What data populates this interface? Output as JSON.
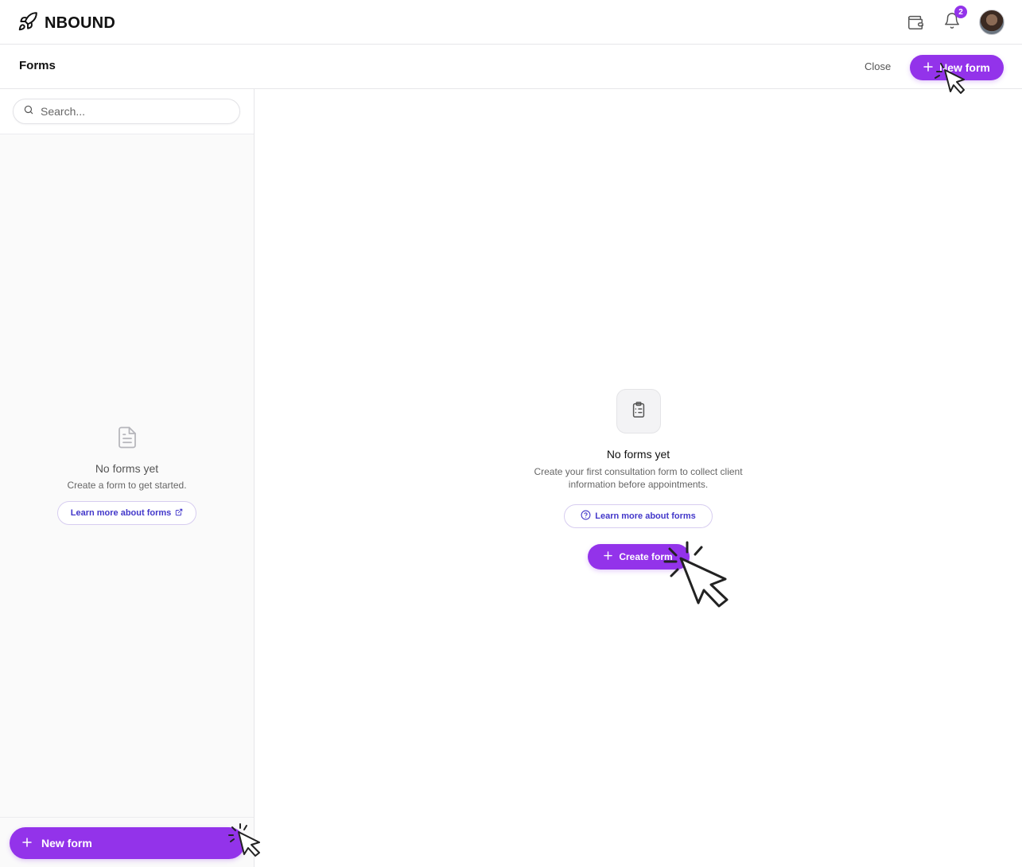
{
  "app": {
    "brand_name": "NBOUND",
    "notification_count": "2"
  },
  "header": {
    "title": "Forms",
    "close_label": "Close",
    "new_form_label": "New form"
  },
  "sidebar": {
    "search_placeholder": "Search...",
    "empty_title": "No forms yet",
    "empty_subtitle": "Create a form to get started.",
    "learn_more_label": "Learn more about forms",
    "new_form_label": "New form"
  },
  "main": {
    "empty_title": "No forms yet",
    "empty_description": "Create your first consultation form to collect client information before appointments.",
    "learn_more_label": "Learn more about forms",
    "create_label": "Create form"
  },
  "icons": {
    "brand": "rocket-icon",
    "wallet": "wallet-icon",
    "notifications": "bell-icon",
    "search": "search-icon",
    "document": "document-icon",
    "clipboard": "clipboard-icon",
    "external_link": "external-link-icon",
    "help": "help-circle-icon",
    "plus": "plus-icon"
  },
  "colors": {
    "accent": "#9333ea",
    "link": "#4338ca",
    "border": "#e6e6e9",
    "sidebar_bg": "#fafafa"
  }
}
